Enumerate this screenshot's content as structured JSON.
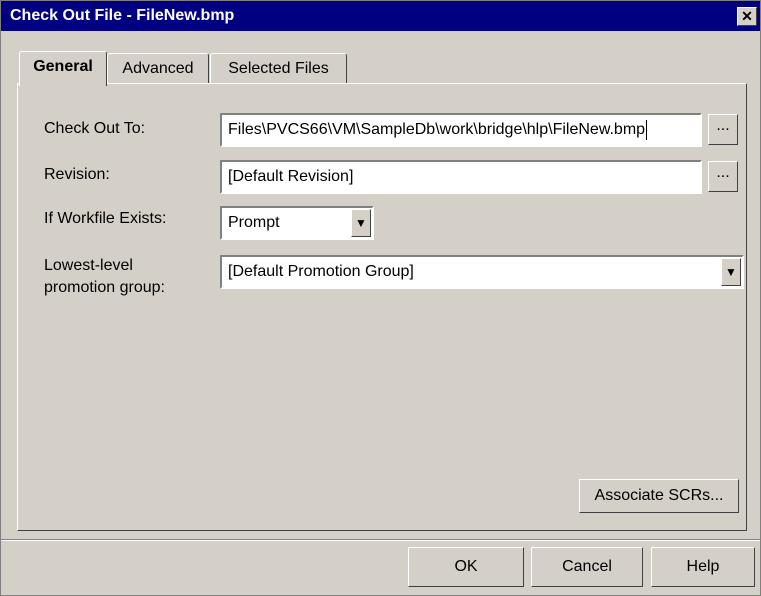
{
  "window": {
    "title": "Check Out File - FileNew.bmp"
  },
  "tabs": [
    {
      "label": "General",
      "active": true
    },
    {
      "label": "Advanced",
      "active": false
    },
    {
      "label": "Selected Files",
      "active": false
    }
  ],
  "form": {
    "check_out_to": {
      "label": "Check Out To:",
      "value": "Files\\PVCS66\\VM\\SampleDb\\work\\bridge\\hlp\\FileNew.bmp",
      "browse_label": "..."
    },
    "revision": {
      "label": "Revision:",
      "value": "[Default Revision]",
      "browse_label": "..."
    },
    "if_workfile_exists": {
      "label": "If Workfile Exists:",
      "value": "Prompt"
    },
    "promotion_group": {
      "label_line1": "Lowest-level",
      "label_line2": "promotion group:",
      "value": "[Default Promotion Group]"
    }
  },
  "associate_scrs_label": "Associate SCRs...",
  "footer": {
    "ok_label": "OK",
    "cancel_label": "Cancel",
    "help_label": "Help"
  },
  "icons": {
    "close": "close-icon",
    "dropdown": "chevron-down-icon"
  }
}
